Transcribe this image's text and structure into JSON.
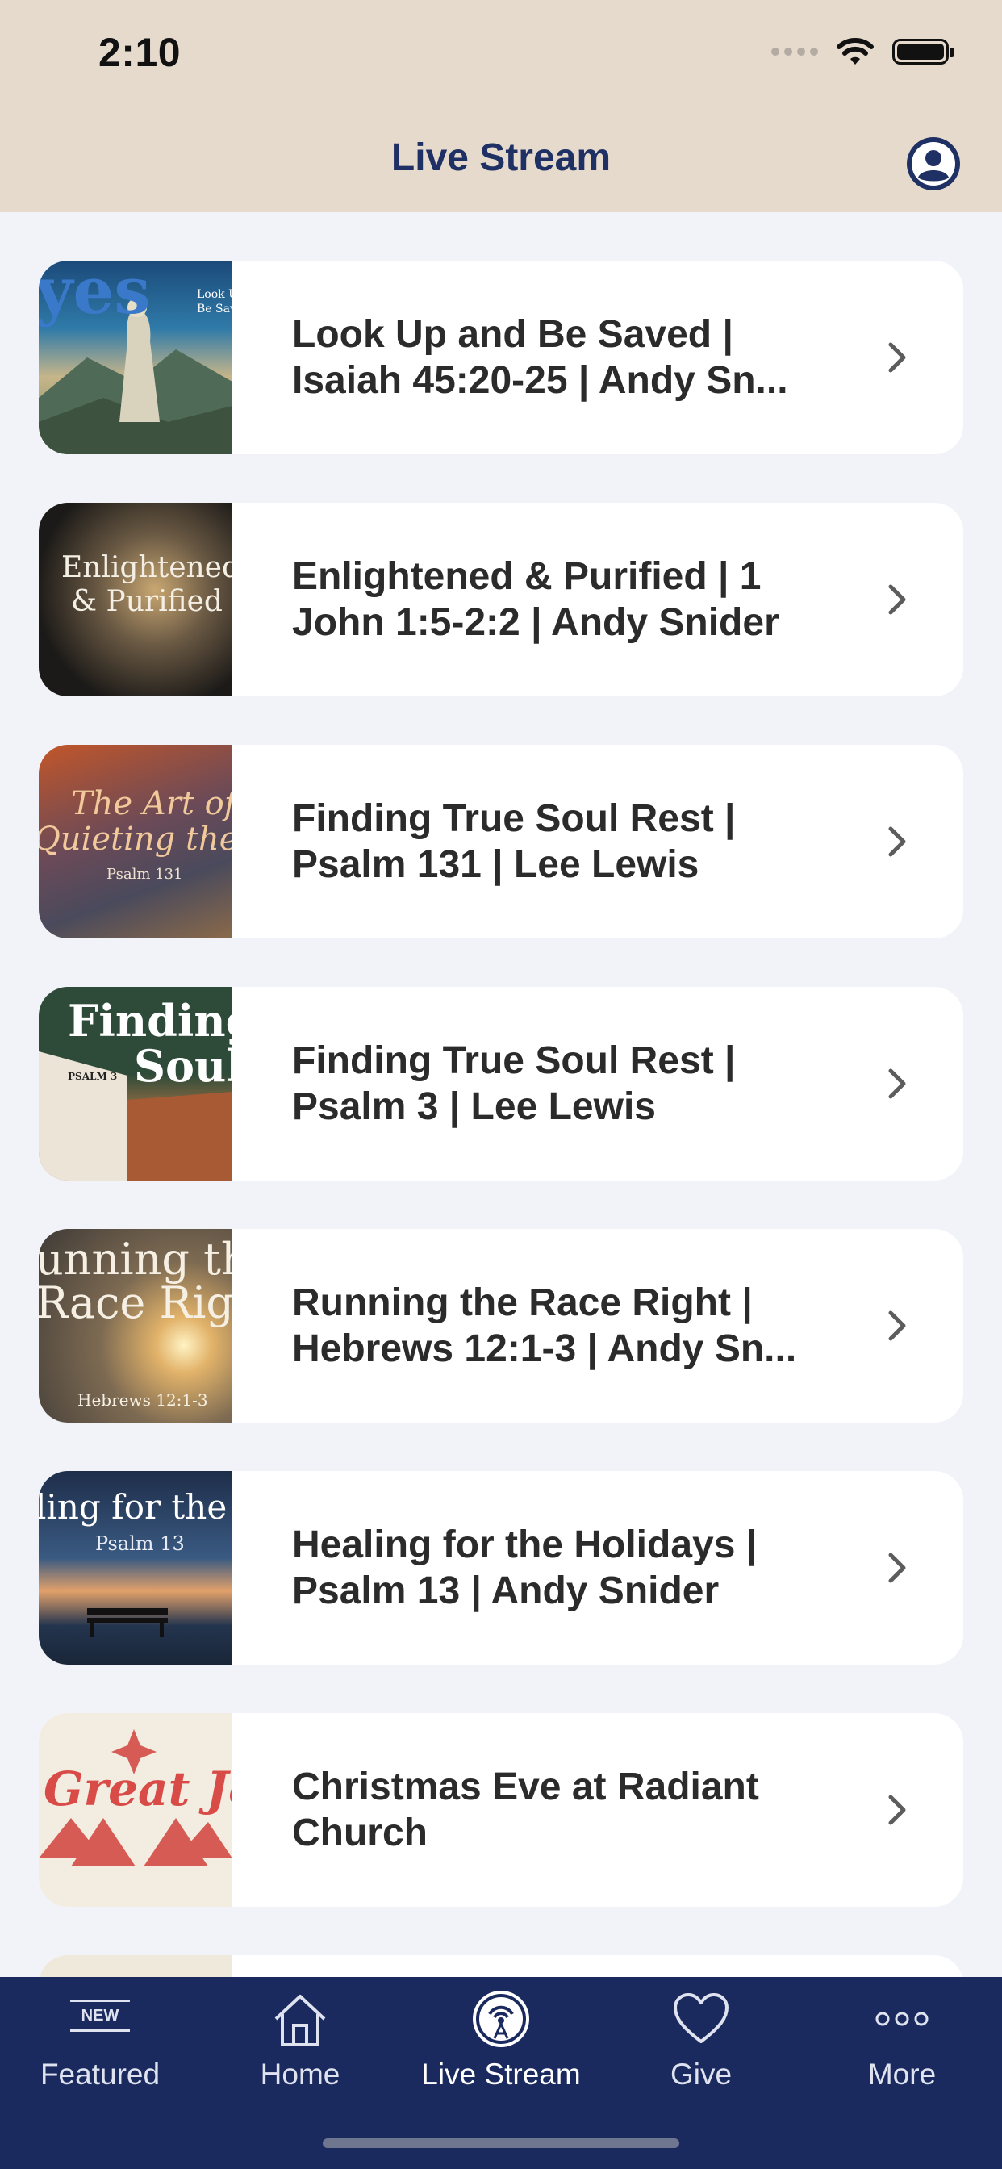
{
  "status_bar": {
    "time": "2:10"
  },
  "header": {
    "title": "Live Stream",
    "profile_icon": "profile-icon"
  },
  "list": {
    "items": [
      {
        "title": "Look Up and Be Saved | Isaiah 45:20-25 | Andy Sn...",
        "thumb_lines": [
          "Look U",
          "Be Sav"
        ],
        "thumb_theme": "look-up"
      },
      {
        "title": "Enlightened & Purified | 1 John 1:5-2:2 | Andy Snider",
        "thumb_lines": [
          "Enlightened",
          "& Purified"
        ],
        "thumb_theme": "enlightened"
      },
      {
        "title": "Finding True Soul Rest | Psalm 131 | Lee Lewis",
        "thumb_lines": [
          "The Art of",
          "Quieting the Sou",
          "Psalm 131"
        ],
        "thumb_theme": "quieting"
      },
      {
        "title": "Finding True Soul Rest | Psalm 3 | Lee Lewis",
        "thumb_lines": [
          "Finding Tr",
          "Soul R",
          "PSALM 3"
        ],
        "thumb_theme": "finding"
      },
      {
        "title": "Running the Race Right | Hebrews 12:1-3 | Andy Sn...",
        "thumb_lines": [
          "unning th",
          "Race Right",
          "Hebrews 12:1-3"
        ],
        "thumb_theme": "race"
      },
      {
        "title": "Healing for the Holidays | Psalm 13 | Andy Snider",
        "thumb_lines": [
          "ling for the Holid",
          "Psalm 13"
        ],
        "thumb_theme": "healing"
      },
      {
        "title": "Christmas Eve at Radiant Church",
        "thumb_lines": [
          "Great Joy"
        ],
        "thumb_theme": "joy"
      }
    ]
  },
  "tabbar": {
    "tabs": [
      {
        "label": "Featured",
        "icon": "new-badge-icon",
        "badge": "NEW"
      },
      {
        "label": "Home",
        "icon": "house-icon"
      },
      {
        "label": "Live Stream",
        "icon": "broadcast-icon",
        "active": true
      },
      {
        "label": "Give",
        "icon": "heart-icon"
      },
      {
        "label": "More",
        "icon": "more-dots-icon"
      }
    ]
  },
  "colors": {
    "header_bg": "#e6dacd",
    "title": "#1f3064",
    "tabbar_bg": "#1b2a5e",
    "page_bg": "#f1f3f8"
  }
}
